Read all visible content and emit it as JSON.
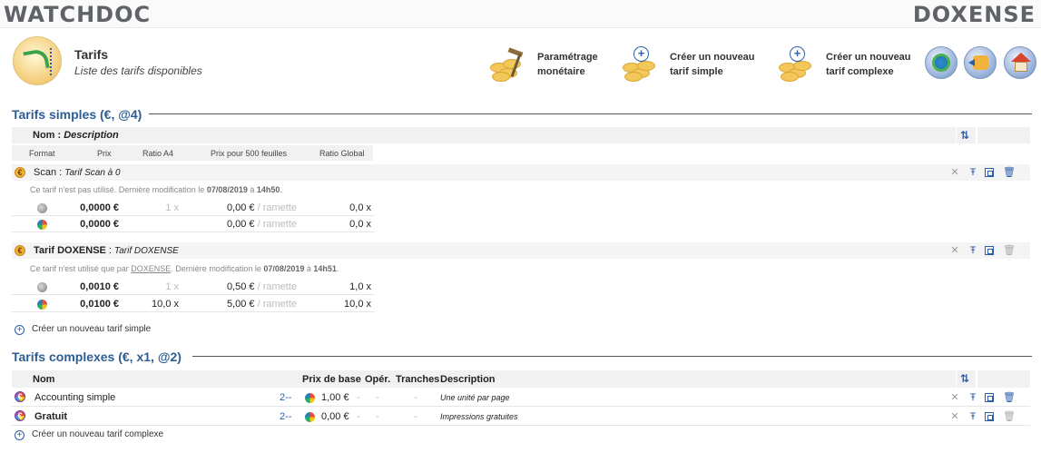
{
  "brand": {
    "left": "WATCHDOC",
    "right": "DOXENSE"
  },
  "header": {
    "title": "Tarifs",
    "subtitle": "Liste des tarifs disponibles",
    "actions": [
      {
        "label_line1": "Paramétrage",
        "label_line2": "monétaire"
      },
      {
        "label_line1": "Créer un nouveau",
        "label_line2": "tarif simple"
      },
      {
        "label_line1": "Créer un nouveau",
        "label_line2": "tarif complexe"
      }
    ]
  },
  "simple": {
    "title": "Tarifs simples (€, @4)",
    "head_name": "Nom",
    "head_desc": "Description",
    "columns": [
      "Format",
      "Prix",
      "Ratio A4",
      "Prix pour 500 feuilles",
      "Ratio Global"
    ],
    "tariffs": [
      {
        "name": "Scan",
        "description": "Tarif Scan à 0",
        "note_prefix": "Ce tarif n'est pas utilisé. Dernière modification le ",
        "note_date": "07/08/2019",
        "note_mid": " à ",
        "note_time": "14h50",
        "note_end": ".",
        "rows": [
          {
            "price": "0,0000 €",
            "ratio": "1 x",
            "p500": "0,00 €",
            "p500_unit": "/ ramette",
            "global": "0,0 x"
          },
          {
            "price": "0,0000 €",
            "ratio": "",
            "p500": "0,00 €",
            "p500_unit": "/ ramette",
            "global": "0,0 x"
          }
        ]
      },
      {
        "name": "Tarif DOXENSE",
        "description": "Tarif DOXENSE",
        "note_prefix": "Ce tarif n'est utilisé que par ",
        "note_link": "DOXENSE",
        "note_mid2": ". Dernière modification le ",
        "note_date": "07/08/2019",
        "note_mid": " à ",
        "note_time": "14h51",
        "note_end": ".",
        "rows": [
          {
            "price": "0,0010 €",
            "ratio": "1 x",
            "p500": "0,50 €",
            "p500_unit": "/ ramette",
            "global": "1,0 x"
          },
          {
            "price": "0,0100 €",
            "ratio": "10,0 x",
            "p500": "5,00 €",
            "p500_unit": "/ ramette",
            "global": "10,0 x"
          }
        ]
      }
    ],
    "create_label": "Créer un nouveau tarif simple"
  },
  "complex": {
    "title": "Tarifs complexes (€, x1, @2)",
    "columns": {
      "name": "Nom",
      "base": "Prix de base",
      "op": "Opér.",
      "tranches": "Tranches",
      "desc": "Description"
    },
    "rows": [
      {
        "name": "Accounting simple",
        "count": "2--",
        "base": "1,00 €",
        "op": "-",
        "dash2": "-",
        "tranches": "-",
        "desc": "Une unité par page",
        "bold": false
      },
      {
        "name": "Gratuit",
        "count": "2--",
        "base": "0,00 €",
        "op": "-",
        "dash2": "-",
        "tranches": "-",
        "desc": "Impressions gratuites",
        "bold": true
      }
    ],
    "create_label": "Créer un nouveau tarif complexe"
  },
  "icons": {
    "sync": "sync-icon",
    "close": "close-icon",
    "edit": "settings-edit-icon",
    "copy": "duplicate-icon",
    "trash": "trash-icon"
  }
}
